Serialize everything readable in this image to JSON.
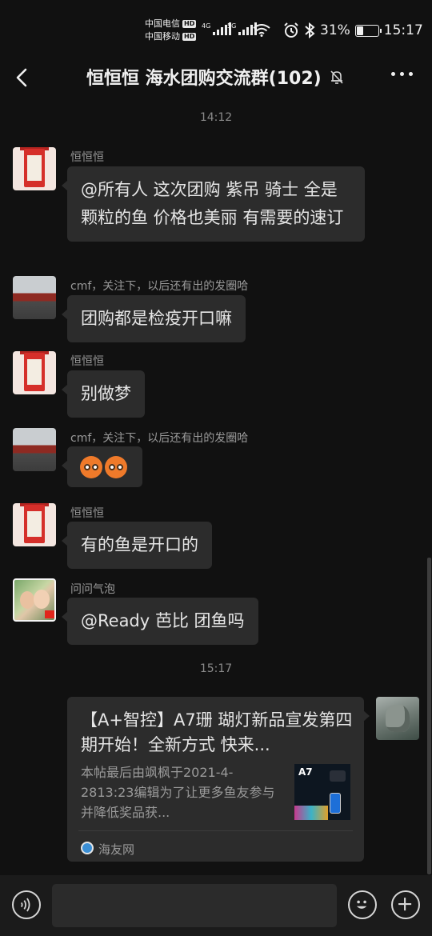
{
  "status_bar": {
    "carrier1": "中国电信",
    "carrier2": "中国移动",
    "hd_badge": "HD",
    "net1": "4G",
    "net2": "5G",
    "battery_percent": "31%",
    "battery_level": 0.31,
    "time": "15:17"
  },
  "header": {
    "title": "恒恒恒  海水团购交流群(102)"
  },
  "timestamps": [
    "14:12",
    "15:17"
  ],
  "messages": [
    {
      "sender": "恒恒恒",
      "text": "@所有人   这次团购 紫吊 骑士 全是颗粒的鱼 价格也美丽 有需要的速订"
    },
    {
      "sender": "cmf，关注下，以后还有出的发圈哈",
      "text": "团购都是检疫开口嘛"
    },
    {
      "sender": "恒恒恒",
      "text": "别做梦"
    },
    {
      "sender": "cmf，关注下，以后还有出的发圈哈",
      "text": ""
    },
    {
      "sender": "恒恒恒",
      "text": "有的鱼是开口的"
    },
    {
      "sender": "问问气泡",
      "text": "@Ready 芭比  团鱼吗"
    }
  ],
  "link_card": {
    "title": "【A+智控】A7珊 瑚灯新品宣发第四期开始！全新方式  快来...",
    "description": "本帖最后由飒枫于2021-4-2813:23编辑为了让更多鱼友参与并降低奖品获...",
    "thumb_label": "A7",
    "source": "海友网"
  },
  "colors": {
    "background": "#111111",
    "bubble": "#2c2c2c",
    "text": "#e6e6e6"
  }
}
